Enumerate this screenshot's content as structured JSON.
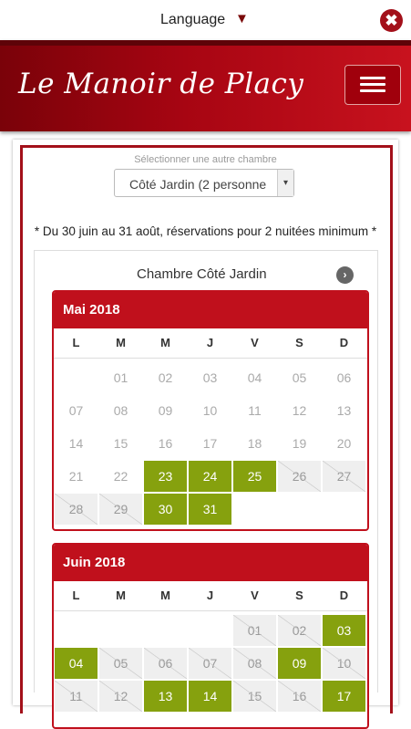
{
  "topbar": {
    "language_label": "Language",
    "caret": "▼",
    "close_glyph": "✖"
  },
  "header": {
    "logo_text": "Le Manoir de Placy"
  },
  "room_select": {
    "label": "Sélectionner une autre chambre",
    "value": "Côté Jardin (2 personne"
  },
  "notice": "* Du 30 juin au 31 août, réservations pour 2 nuitées minimum *",
  "calendar": {
    "room_title": "Chambre Côté Jardin",
    "weekdays": [
      "L",
      "M",
      "M",
      "J",
      "V",
      "S",
      "D"
    ],
    "months": [
      {
        "title": "Mai 2018",
        "first_col": 1,
        "days": [
          {
            "d": "01",
            "s": "past"
          },
          {
            "d": "02",
            "s": "past"
          },
          {
            "d": "03",
            "s": "past"
          },
          {
            "d": "04",
            "s": "past"
          },
          {
            "d": "05",
            "s": "past"
          },
          {
            "d": "06",
            "s": "past"
          },
          {
            "d": "07",
            "s": "past"
          },
          {
            "d": "08",
            "s": "past"
          },
          {
            "d": "09",
            "s": "past"
          },
          {
            "d": "10",
            "s": "past"
          },
          {
            "d": "11",
            "s": "past"
          },
          {
            "d": "12",
            "s": "past"
          },
          {
            "d": "13",
            "s": "past"
          },
          {
            "d": "14",
            "s": "past"
          },
          {
            "d": "15",
            "s": "past"
          },
          {
            "d": "16",
            "s": "past"
          },
          {
            "d": "17",
            "s": "past"
          },
          {
            "d": "18",
            "s": "past"
          },
          {
            "d": "19",
            "s": "past"
          },
          {
            "d": "20",
            "s": "past"
          },
          {
            "d": "21",
            "s": "past"
          },
          {
            "d": "22",
            "s": "past"
          },
          {
            "d": "23",
            "s": "avail"
          },
          {
            "d": "24",
            "s": "avail"
          },
          {
            "d": "25",
            "s": "avail"
          },
          {
            "d": "26",
            "s": "booked"
          },
          {
            "d": "27",
            "s": "booked"
          },
          {
            "d": "28",
            "s": "booked"
          },
          {
            "d": "29",
            "s": "booked"
          },
          {
            "d": "30",
            "s": "avail"
          },
          {
            "d": "31",
            "s": "avail"
          }
        ]
      },
      {
        "title": "Juin 2018",
        "first_col": 4,
        "days": [
          {
            "d": "01",
            "s": "booked"
          },
          {
            "d": "02",
            "s": "booked"
          },
          {
            "d": "03",
            "s": "avail"
          },
          {
            "d": "04",
            "s": "avail"
          },
          {
            "d": "05",
            "s": "booked"
          },
          {
            "d": "06",
            "s": "booked"
          },
          {
            "d": "07",
            "s": "booked"
          },
          {
            "d": "08",
            "s": "booked"
          },
          {
            "d": "09",
            "s": "avail"
          },
          {
            "d": "10",
            "s": "booked"
          },
          {
            "d": "11",
            "s": "booked"
          },
          {
            "d": "12",
            "s": "booked"
          },
          {
            "d": "13",
            "s": "avail"
          },
          {
            "d": "14",
            "s": "avail"
          },
          {
            "d": "15",
            "s": "booked"
          },
          {
            "d": "16",
            "s": "booked"
          },
          {
            "d": "17",
            "s": "avail"
          }
        ]
      }
    ]
  },
  "colors": {
    "brand_red": "#c0101c",
    "available_green": "#86a10e",
    "booked_gray": "#efefef"
  }
}
